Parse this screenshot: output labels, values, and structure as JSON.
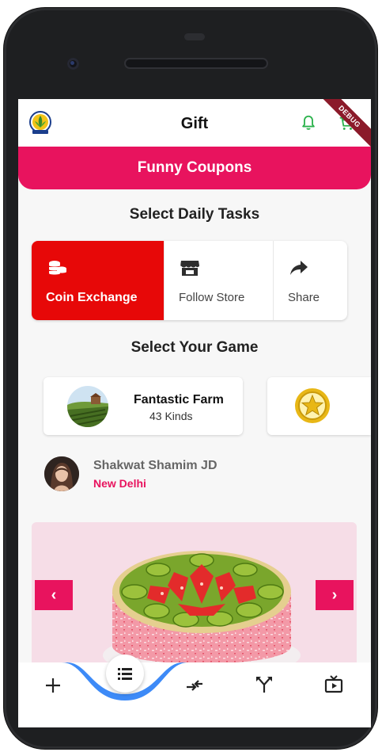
{
  "app": {
    "title": "Gift",
    "debug_label": "DEBUG"
  },
  "banner": {
    "label": "Funny Coupons"
  },
  "daily_tasks": {
    "heading": "Select Daily Tasks",
    "items": [
      {
        "label": "Coin Exchange",
        "icon": "coins-icon",
        "active": true
      },
      {
        "label": "Follow Store",
        "icon": "store-icon",
        "active": false
      },
      {
        "label": "Share",
        "icon": "share-icon",
        "active": false
      }
    ]
  },
  "games": {
    "heading": "Select Your Game",
    "items": [
      {
        "name": "Fantastic Farm",
        "count": "43 Kinds",
        "icon": "farm-thumbnail"
      },
      {
        "name": "",
        "count": "",
        "icon": "star-coin-icon"
      }
    ]
  },
  "user": {
    "name": "Shakwat Shamim JD",
    "location": "New Delhi"
  },
  "carousel": {
    "prev": "‹",
    "next": "›",
    "image": "fruit-cake-image"
  },
  "bottom_nav": {
    "items": [
      "add-icon",
      "list-icon",
      "exchange-icon",
      "split-arrows-icon",
      "tv-play-icon"
    ]
  },
  "colors": {
    "primary": "#e8135e",
    "task_active": "#e70808",
    "nav_curve": "#3d8af7",
    "bell": "#2bb24c"
  }
}
